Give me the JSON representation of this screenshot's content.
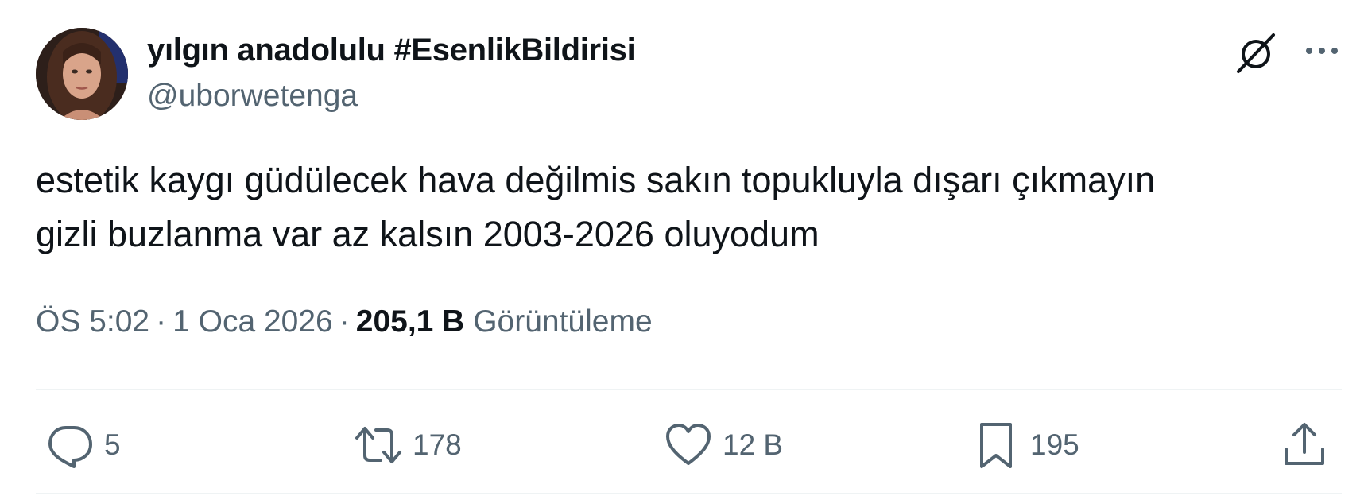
{
  "author": {
    "display_name": "yılgın anadolulu #EsenlikBildirisi",
    "handle": "@uborwetenga"
  },
  "header_icons": {
    "grok": "grok-icon",
    "more": "more-options-icon"
  },
  "tweet": {
    "text_lines": [
      "estetik kaygı güdülecek hava değilmis sakın topukluyla dışarı çıkmayın",
      "gizli buzlanma var az kalsın 2003-2026 oluyodum"
    ],
    "time": "ÖS 5:02",
    "date": "1 Oca 2026",
    "separator": "·",
    "views_count": "205,1 B",
    "views_label": "Görüntüleme"
  },
  "actions": {
    "reply_count": "5",
    "retweet_count": "178",
    "like_count": "12 B",
    "bookmark_count": "195"
  },
  "colors": {
    "text_primary": "#0f1419",
    "text_secondary": "#536471",
    "divider": "#eff3f4",
    "background": "#ffffff"
  }
}
